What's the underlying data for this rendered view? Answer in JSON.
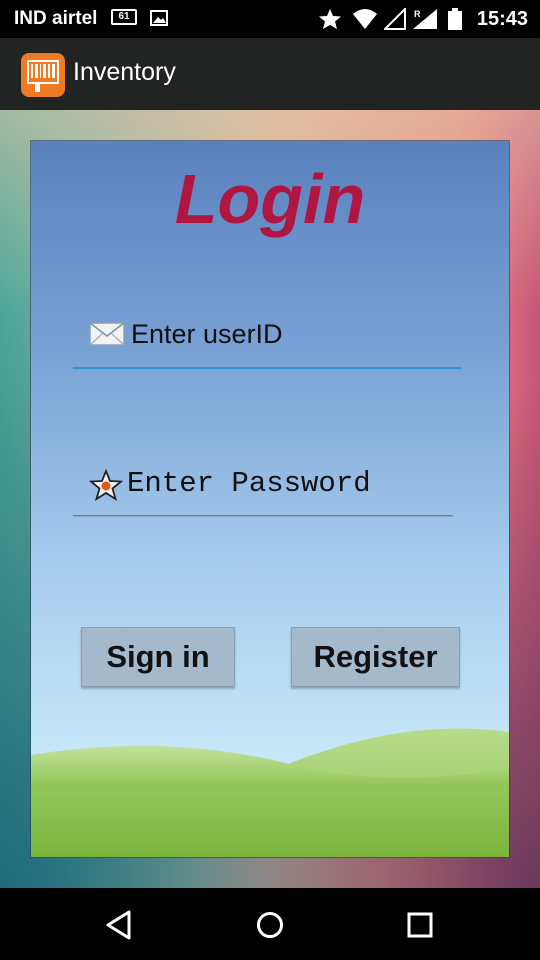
{
  "status_bar": {
    "carrier": "IND airtel",
    "sim_badge": "61",
    "time": "15:43",
    "icons": [
      "gallery-icon",
      "star-icon",
      "wifi-icon",
      "signal-icon",
      "roaming-signal-icon",
      "battery-icon"
    ]
  },
  "app_bar": {
    "title": "Inventory",
    "logo_icon": "barcode-icon",
    "accent": "#ef7a22"
  },
  "login": {
    "title": "Login",
    "title_color": "#b0163f",
    "userid_placeholder": "Enter userID",
    "userid_icon": "envelope-icon",
    "password_placeholder": "Enter Password",
    "password_icon": "star-icon",
    "signin_label": "Sign in",
    "register_label": "Register"
  },
  "nav_bar": {
    "buttons": [
      "back-icon",
      "home-icon",
      "recents-icon"
    ]
  }
}
